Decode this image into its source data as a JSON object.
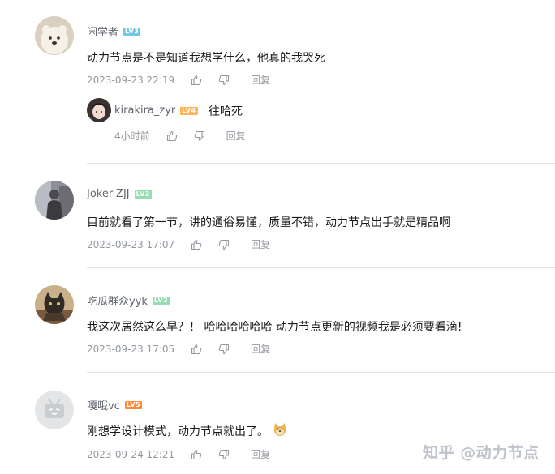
{
  "comments": [
    {
      "username": "闲学者",
      "level": "LV3",
      "level_color": "#73c9e5",
      "text": "动力节点是不是知道我想学什么，他真的我哭死",
      "time": "2023-09-23 22:19",
      "reply_label": "回复",
      "avatar_icon": "polar-bear-avatar",
      "replies": [
        {
          "username": "kirakira_zyr",
          "level": "LV4",
          "level_color": "#feb45a",
          "text": "往哈死",
          "time": "4小时前",
          "reply_label": "回复",
          "avatar_icon": "anime-girl-avatar"
        }
      ]
    },
    {
      "username": "Joker-ZJJ",
      "level": "LV2",
      "level_color": "#95ddb2",
      "text": "目前就看了第一节，讲的通俗易懂，质量不错，动力节点出手就是精品啊",
      "time": "2023-09-23 17:07",
      "reply_label": "回复",
      "avatar_icon": "photo-person-avatar"
    },
    {
      "username": "吃瓜群众yyk",
      "level": "LV2",
      "level_color": "#95ddb2",
      "text": "我这次居然这么早？！ 哈哈哈哈哈哈 动力节点更新的视频我是必须要看滴!",
      "time": "2023-09-23 17:05",
      "reply_label": "回复",
      "avatar_icon": "cat-portrait-avatar"
    },
    {
      "username": "嘎哦vc",
      "level": "LV5",
      "level_color": "#ff8b3d",
      "text": "刚想学设计模式，动力节点就出了。",
      "emoji": "doge-emoji",
      "time": "2023-09-24 12:21",
      "reply_label": "回复",
      "avatar_icon": "bilibili-tv-default-avatar"
    }
  ],
  "watermark": "知乎 @动力节点"
}
